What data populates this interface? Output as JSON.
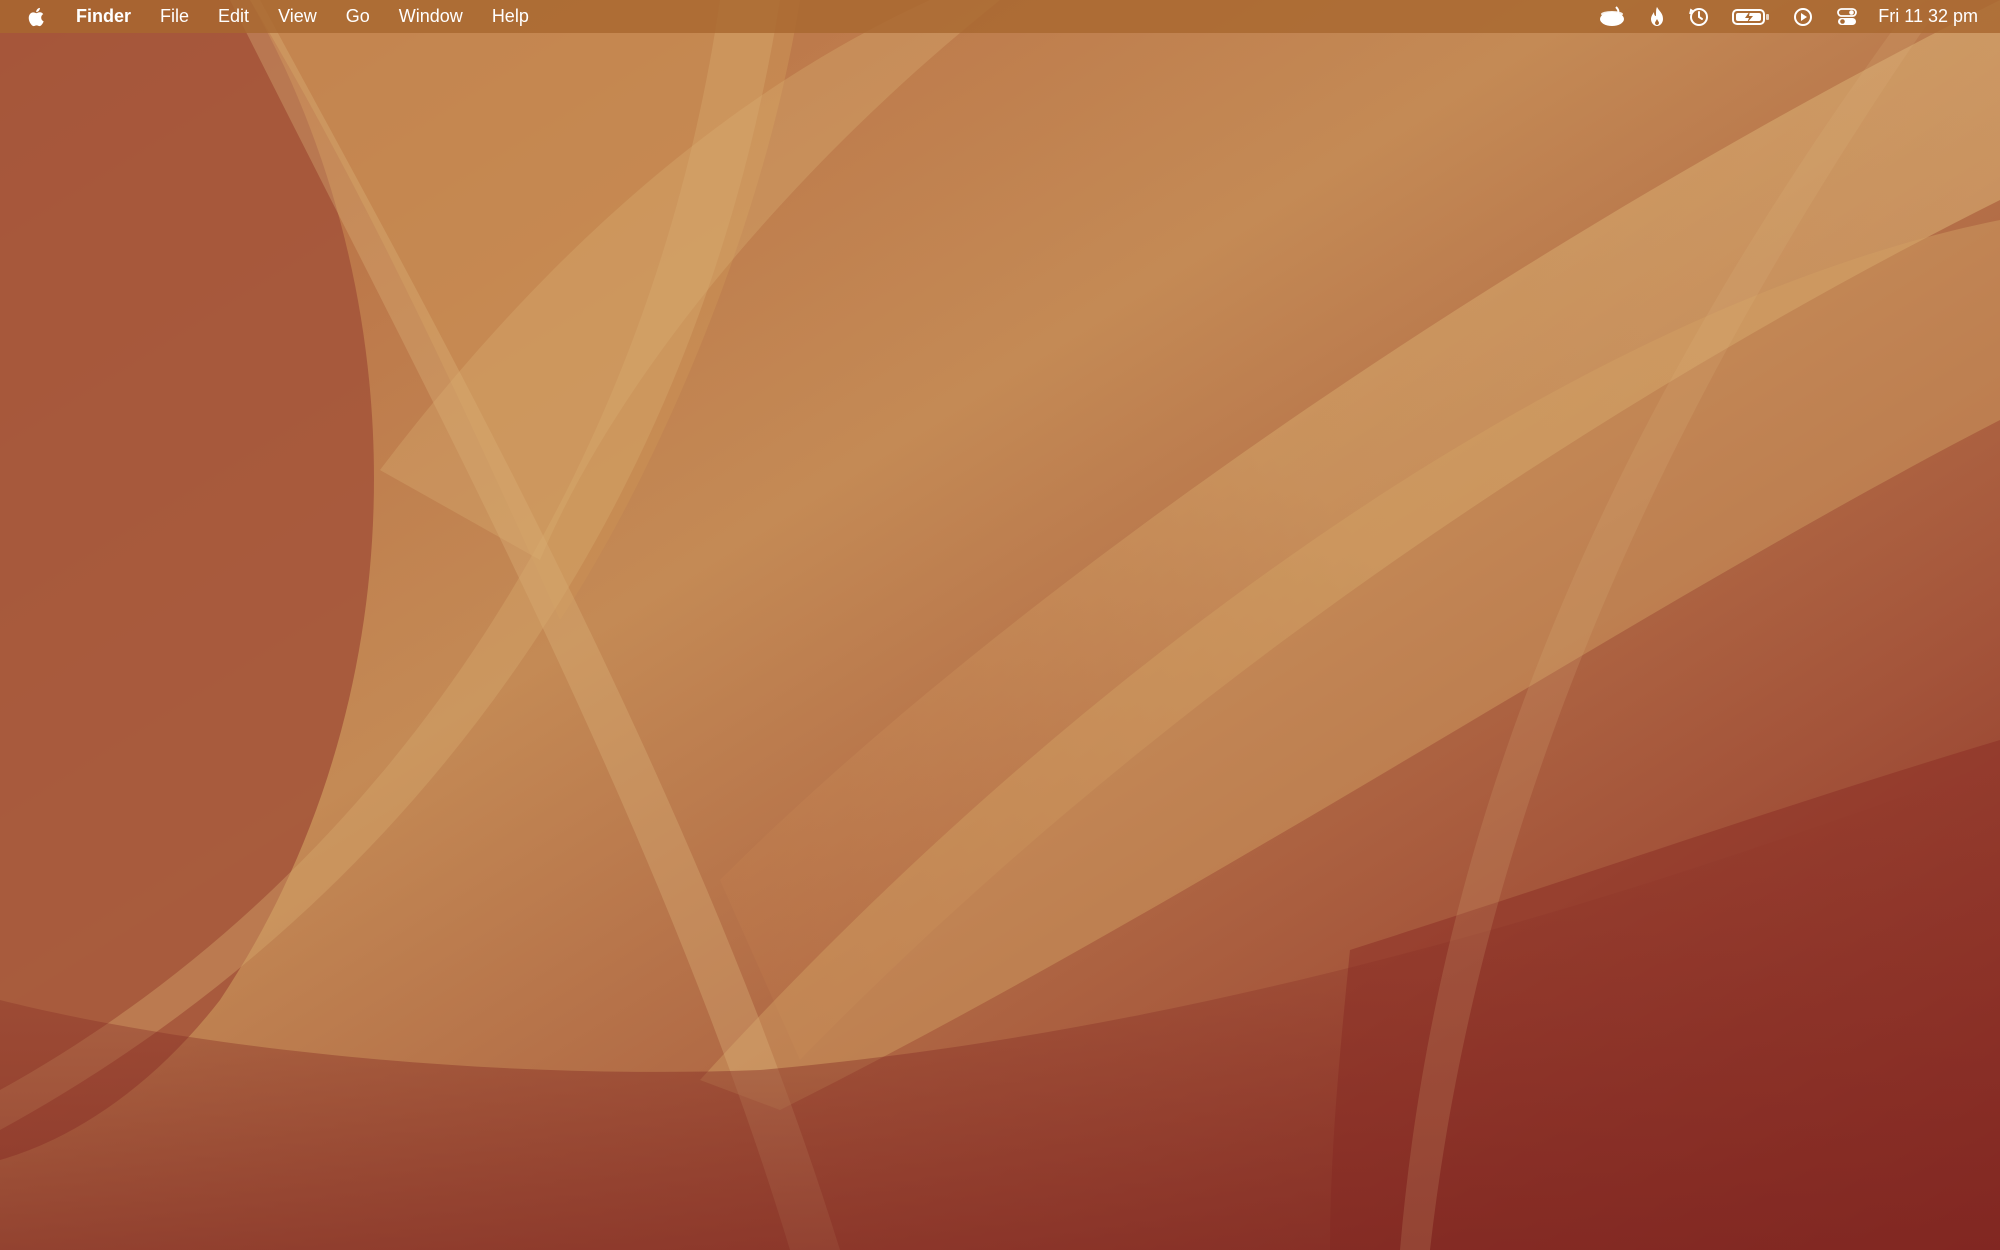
{
  "menubar": {
    "apple_icon": "apple-logo-icon",
    "app_name": "Finder",
    "menus": [
      "File",
      "Edit",
      "View",
      "Go",
      "Window",
      "Help"
    ],
    "status_icons": [
      "bowl-icon",
      "flame-icon",
      "time-machine-icon",
      "battery-charging-icon",
      "play-icon",
      "control-center-icon"
    ],
    "clock": "Fri 11 32 pm"
  },
  "wallpaper": {
    "colors": [
      "#a85a3c",
      "#c9955a",
      "#d6ab70",
      "#8a2e26"
    ]
  }
}
